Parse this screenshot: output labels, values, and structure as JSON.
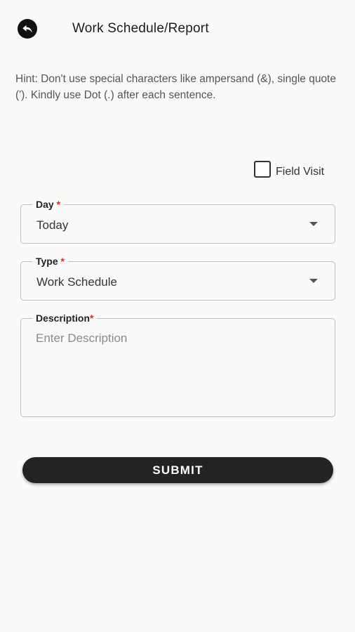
{
  "header": {
    "title": "Work Schedule/Report",
    "back_icon": "back-arrow-icon"
  },
  "hint": "Hint: Don't use special characters like ampersand (&), single quote ('). Kindly use Dot (.) after each sentence.",
  "field_visit": {
    "label": "Field Visit",
    "checked": false
  },
  "day": {
    "label": "Day",
    "required_mark": "*",
    "value": "Today"
  },
  "type": {
    "label": "Type",
    "required_mark": "*",
    "value": "Work Schedule"
  },
  "description": {
    "label": "Description",
    "required_mark": "*",
    "placeholder": "Enter Description",
    "value": ""
  },
  "submit": {
    "label": "SUBMIT"
  },
  "colors": {
    "background": "#fbfaf9",
    "button": "#232323",
    "required": "#d32f2f"
  }
}
